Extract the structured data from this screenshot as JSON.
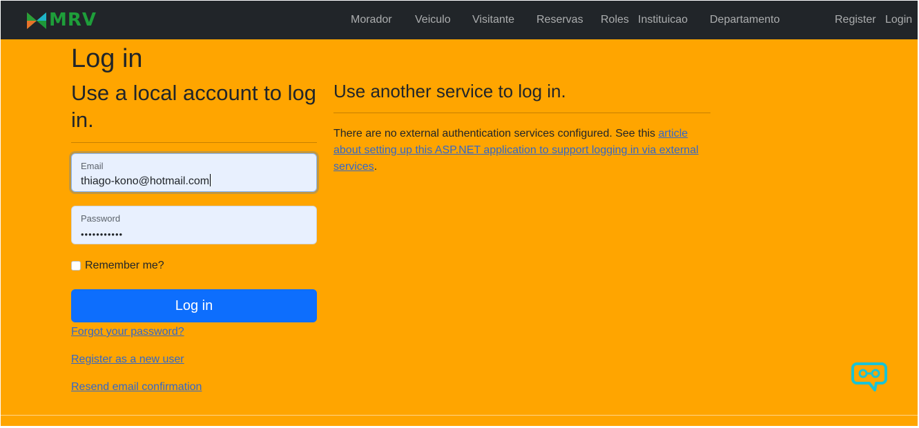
{
  "brand": {
    "name": "MRV",
    "color": "#1e9e3a"
  },
  "nav": {
    "items": [
      {
        "label": "Morador"
      },
      {
        "label": "Veiculo"
      },
      {
        "label": "Visitante"
      },
      {
        "label": "Reservas"
      },
      {
        "label": "Roles"
      },
      {
        "label": "Instituicao"
      },
      {
        "label": "Departamento"
      }
    ],
    "register": "Register",
    "login": "Login"
  },
  "page": {
    "title": "Log in",
    "local_heading": "Use a local account to log in.",
    "external_heading": "Use another service to log in.",
    "background": "#ffa500"
  },
  "form": {
    "email": {
      "label": "Email",
      "value": "thiago-kono@hotmail.com"
    },
    "password": {
      "label": "Password",
      "value": "•••••••••••"
    },
    "remember_label": "Remember me?",
    "remember_checked": false,
    "submit_label": "Log in",
    "primary_color": "#0d6efd"
  },
  "links": {
    "forgot": "Forgot your password?",
    "register": "Register as a new user",
    "resend": "Resend email confirmation"
  },
  "external": {
    "text_before": "There are no external authentication services configured. See this ",
    "link_text": "article about setting up this ASP.NET application to support logging in via external services",
    "text_after": "."
  },
  "widget": {
    "icon": "chatbot-icon"
  }
}
